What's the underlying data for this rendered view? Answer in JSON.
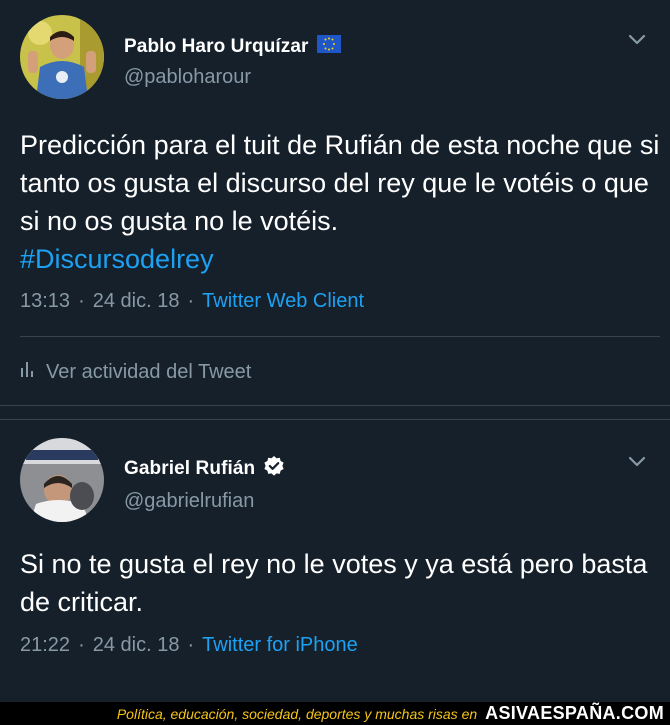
{
  "tweets": [
    {
      "name": "Pablo Haro Urquízar",
      "handle": "@pabloharour",
      "text": "Predicción para el tuit de Rufián de esta noche que si tanto os gusta el discurso del rey que le votéis o que si no os gusta no le votéis.",
      "hashtag": "#Discursodelrey",
      "time": "13:13",
      "date": "24 dic. 18",
      "source": "Twitter Web Client",
      "activity": "Ver actividad del Tweet",
      "badge": "eu-flag-icon"
    },
    {
      "name": "Gabriel Rufián",
      "handle": "@gabrielrufian",
      "text": "Si no te gusta el rey no le votes y ya está pero basta de criticar.",
      "time": "21:22",
      "date": "24 dic. 18",
      "source": "Twitter for iPhone",
      "badge": "verified-icon"
    }
  ],
  "separator": "·",
  "footer": {
    "tagline": "Política, educación, sociedad, deportes y muchas risas en",
    "site": "ASIVAESPAÑA.COM"
  },
  "colors": {
    "background": "#15202b",
    "link": "#1da1f2",
    "muted": "#8899a6",
    "divider": "#38444d"
  }
}
